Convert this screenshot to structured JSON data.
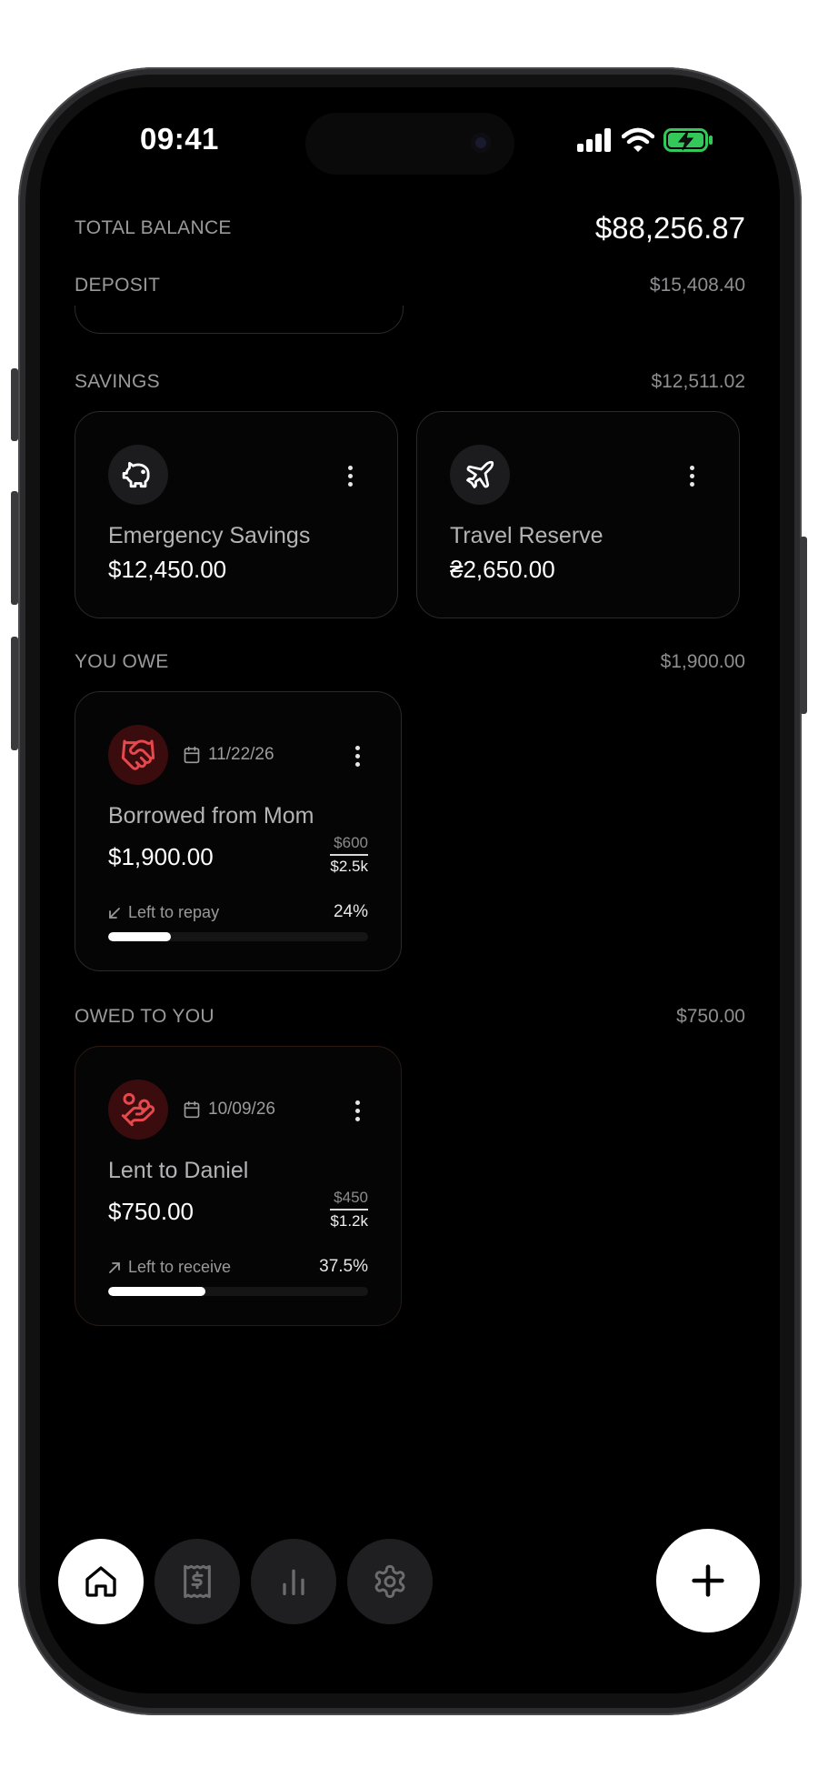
{
  "status": {
    "time": "09:41"
  },
  "total": {
    "label": "TOTAL BALANCE",
    "amount": "$88,256.87"
  },
  "deposit": {
    "label": "DEPOSIT",
    "amount": "$15,408.40"
  },
  "savings": {
    "label": "SAVINGS",
    "amount": "$12,511.02",
    "cards": [
      {
        "name": "Emergency Savings",
        "value": "$12,450.00",
        "icon": "piggy-bank-icon"
      },
      {
        "name": "Travel Reserve",
        "value": "₴2,650.00",
        "icon": "airplane-icon"
      }
    ]
  },
  "you_owe": {
    "label": "YOU OWE",
    "amount": "$1,900.00",
    "card": {
      "date": "11/22/26",
      "name": "Borrowed from Mom",
      "value": "$1,900.00",
      "paid": "$600",
      "total": "$2.5k",
      "progress_label": "Left to repay",
      "progress_pct": "24%",
      "progress_fraction": 0.24,
      "accent": "#e5484d"
    }
  },
  "owed_to_you": {
    "label": "OWED TO YOU",
    "amount": "$750.00",
    "card": {
      "date": "10/09/26",
      "name": "Lent to Daniel",
      "value": "$750.00",
      "paid": "$450",
      "total": "$1.2k",
      "progress_label": "Left to receive",
      "progress_pct": "37.5%",
      "progress_fraction": 0.375,
      "accent": "#e5484d"
    }
  },
  "nav": {
    "items": [
      "home-icon",
      "receipt-icon",
      "chart-icon",
      "gear-icon"
    ],
    "active": "home-icon",
    "fab": "plus-icon"
  },
  "colors": {
    "background": "#000000",
    "accent_red": "#e5484d",
    "battery": "#34c759"
  }
}
